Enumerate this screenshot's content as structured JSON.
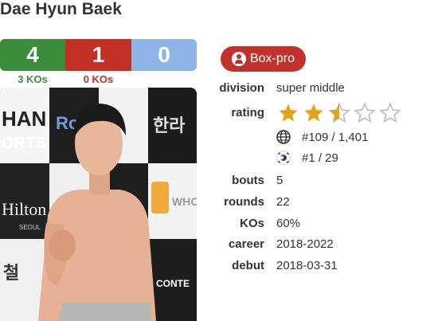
{
  "boxer": {
    "name": "Dae Hyun Baek"
  },
  "record": {
    "wins": "4",
    "losses": "1",
    "draws": "0",
    "wins_ko": "3 KOs",
    "losses_ko": "0 KOs"
  },
  "badge": {
    "label": "Box-pro",
    "icon": "user-circle-icon"
  },
  "details": {
    "division_label": "division",
    "division": "super middle",
    "rating_label": "rating",
    "rating_stars": 2.5,
    "rating_max": 5,
    "world_rank": "#109 / 1,401",
    "country_rank": "#1 / 29",
    "bouts_label": "bouts",
    "bouts": "5",
    "rounds_label": "rounds",
    "rounds": "22",
    "kos_label": "KOs",
    "kos": "60%",
    "career_label": "career",
    "career": "2018-2022",
    "debut_label": "debut",
    "debut": "2018-03-31"
  },
  "colors": {
    "win": "#3b8c3b",
    "loss": "#c23028",
    "draw": "#8fb4e8",
    "badge": "#c0322b",
    "star": "#e8a21a"
  },
  "photo": {
    "icon": "boxer-photo",
    "backdrop_text": [
      "HAN",
      "ORTS",
      "Ro",
      "한라",
      "Hilton",
      "SEOUL",
      "WHO",
      "CONTE",
      "철"
    ]
  }
}
